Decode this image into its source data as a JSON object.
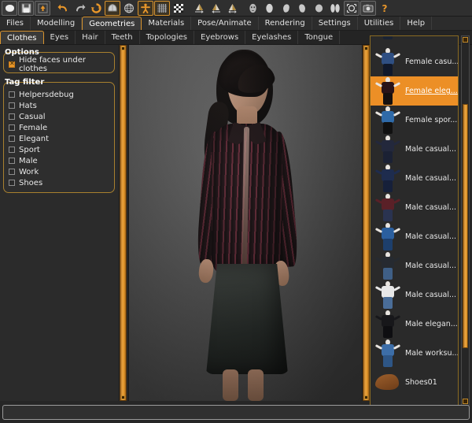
{
  "app": {
    "title": "MakeHuman",
    "accent_color": "#e8962a",
    "panel_bg": "#2b2b2b"
  },
  "toolbar": {
    "buttons": [
      {
        "name": "new-icon",
        "glyph": "new"
      },
      {
        "name": "save-icon",
        "glyph": "save"
      },
      {
        "name": "load-icon",
        "glyph": "load"
      },
      {
        "name": "undo-icon",
        "glyph": "undo"
      },
      {
        "name": "redo-icon",
        "glyph": "redo"
      },
      {
        "name": "reset-icon",
        "glyph": "reset"
      },
      {
        "name": "smooth-icon",
        "glyph": "smooth"
      },
      {
        "name": "wireframe-icon",
        "glyph": "wireframe"
      },
      {
        "name": "pose-icon",
        "glyph": "pose"
      },
      {
        "name": "grid-icon",
        "glyph": "grid"
      },
      {
        "name": "background-icon",
        "glyph": "checker"
      },
      {
        "name": "symmetry-right-icon",
        "glyph": "symR"
      },
      {
        "name": "symmetry-left-icon",
        "glyph": "symL"
      },
      {
        "name": "symmetry-icon",
        "glyph": "sym"
      },
      {
        "name": "front-view-icon",
        "glyph": "front"
      },
      {
        "name": "back-view-icon",
        "glyph": "back"
      },
      {
        "name": "left-view-icon",
        "glyph": "left"
      },
      {
        "name": "right-view-icon",
        "glyph": "right"
      },
      {
        "name": "top-view-icon",
        "glyph": "top"
      },
      {
        "name": "side-by-side-icon",
        "glyph": "sbs"
      },
      {
        "name": "reset-camera-icon",
        "glyph": "resetcam"
      },
      {
        "name": "grab-screen-icon",
        "glyph": "grab"
      },
      {
        "name": "help-icon",
        "glyph": "help"
      }
    ]
  },
  "menu": {
    "items": [
      {
        "label": "Files",
        "selected": false
      },
      {
        "label": "Modelling",
        "selected": false
      },
      {
        "label": "Geometries",
        "selected": true
      },
      {
        "label": "Materials",
        "selected": false
      },
      {
        "label": "Pose/Animate",
        "selected": false
      },
      {
        "label": "Rendering",
        "selected": false
      },
      {
        "label": "Settings",
        "selected": false
      },
      {
        "label": "Utilities",
        "selected": false
      },
      {
        "label": "Help",
        "selected": false
      }
    ]
  },
  "subtabs": {
    "items": [
      {
        "label": "Clothes",
        "selected": true
      },
      {
        "label": "Eyes",
        "selected": false
      },
      {
        "label": "Hair",
        "selected": false
      },
      {
        "label": "Teeth",
        "selected": false
      },
      {
        "label": "Topologies",
        "selected": false
      },
      {
        "label": "Eyebrows",
        "selected": false
      },
      {
        "label": "Eyelashes",
        "selected": false
      },
      {
        "label": "Tongue",
        "selected": false
      }
    ]
  },
  "left_panel": {
    "options_title": "Options",
    "options": [
      {
        "label": "Hide faces under clothes",
        "checked": true
      }
    ],
    "tag_filter_title": "Tag filter",
    "tags": [
      {
        "label": "Helpersdebug",
        "checked": false
      },
      {
        "label": "Hats",
        "checked": false
      },
      {
        "label": "Casual",
        "checked": false
      },
      {
        "label": "Female",
        "checked": false
      },
      {
        "label": "Elegant",
        "checked": false
      },
      {
        "label": "Sport",
        "checked": false
      },
      {
        "label": "Male",
        "checked": false
      },
      {
        "label": "Work",
        "checked": false
      },
      {
        "label": "Shoes",
        "checked": false
      }
    ]
  },
  "clothes_list": {
    "items": [
      {
        "label": "",
        "selected": false,
        "kind": "mannequin",
        "top": "#2b3a55",
        "bottom": "#1a2333",
        "clipped": true
      },
      {
        "label": "Female casu...",
        "selected": false,
        "kind": "mannequin",
        "top": "#2f4f82",
        "bottom": "#10182a"
      },
      {
        "label": "Female eleg...",
        "selected": true,
        "kind": "mannequin",
        "top": "#2a1418",
        "bottom": "#15100f"
      },
      {
        "label": "Female spor...",
        "selected": false,
        "kind": "mannequin",
        "top": "#2f6aa8",
        "bottom": "#101010"
      },
      {
        "label": "Male casual...",
        "selected": false,
        "kind": "mannequin",
        "top": "#23283c",
        "bottom": "#1b2134"
      },
      {
        "label": "Male casual...",
        "selected": false,
        "kind": "mannequin",
        "top": "#1e2c4e",
        "bottom": "#16203a"
      },
      {
        "label": "Male casual...",
        "selected": false,
        "kind": "mannequin",
        "top": "#5a2027",
        "bottom": "#2a3350"
      },
      {
        "label": "Male casual...",
        "selected": false,
        "kind": "mannequin",
        "top": "#2b5f9e",
        "bottom": "#1d3f6c"
      },
      {
        "label": "Male casual...",
        "selected": false,
        "kind": "mannequin",
        "top": "#262a30",
        "bottom": "#3f5f86"
      },
      {
        "label": "Male casual...",
        "selected": false,
        "kind": "mannequin",
        "top": "#e8e8e8",
        "bottom": "#4a6d98"
      },
      {
        "label": "Male elegan...",
        "selected": false,
        "kind": "mannequin",
        "top": "#17171a",
        "bottom": "#0e0e11"
      },
      {
        "label": "Male worksu...",
        "selected": false,
        "kind": "mannequin",
        "top": "#3d6ea8",
        "bottom": "#2e5686"
      },
      {
        "label": "Shoes01",
        "selected": false,
        "kind": "shoe",
        "top": "#8c5426",
        "bottom": "#6d3c18"
      }
    ]
  },
  "viewport": {
    "label": "3d-character-preview"
  },
  "status": {
    "progress_text": ""
  }
}
